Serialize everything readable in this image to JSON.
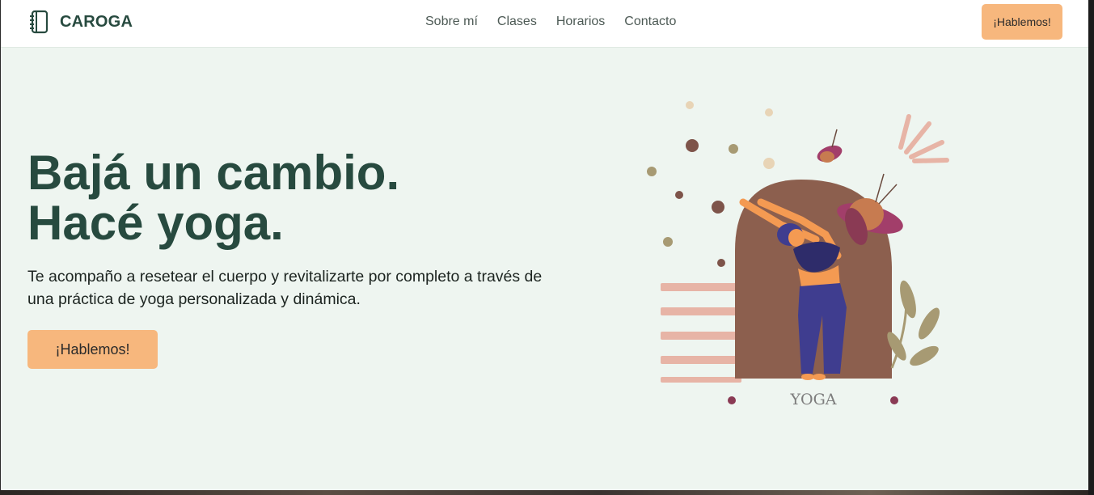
{
  "header": {
    "brand": "CAROGA",
    "brand_icon": "notebook-icon",
    "nav": [
      {
        "label": "Sobre mí"
      },
      {
        "label": "Clases"
      },
      {
        "label": "Horarios"
      },
      {
        "label": "Contacto"
      }
    ],
    "cta_label": "¡Hablemos!"
  },
  "hero": {
    "title_line1": "Bajá un cambio.",
    "title_line2": "Hacé yoga.",
    "description": "Te acompaño a resetear el cuerpo y revitalizarte por completo a través de una práctica de yoga personalizada y dinámica.",
    "cta_label": "¡Hablemos!"
  },
  "illustration": {
    "label": "YOGA"
  },
  "colors": {
    "brand_green": "#274a3f",
    "accent_orange": "#f7b77d",
    "hero_bg": "#eef5f0",
    "arch_brown": "#8c5f4e",
    "stripe_pink": "#e7b4a6"
  }
}
